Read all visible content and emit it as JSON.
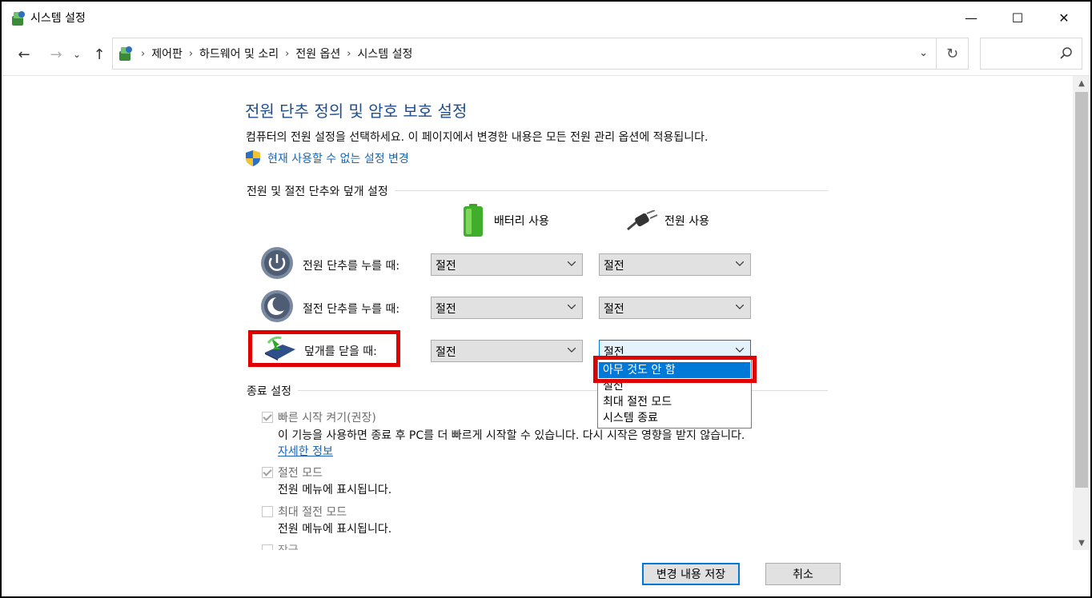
{
  "window": {
    "title": "시스템 설정",
    "minimize_glyph": "—",
    "maximize_glyph": "☐",
    "close_glyph": "✕"
  },
  "nav": {
    "back_glyph": "←",
    "forward_glyph": "→",
    "recent_glyph": "⌄",
    "up_glyph": "↑",
    "breadcrumbs": [
      "제어판",
      "하드웨어 및 소리",
      "전원 옵션",
      "시스템 설정"
    ],
    "separator": "›",
    "refresh_glyph": "↻",
    "search_placeholder": ""
  },
  "page": {
    "title": "전원 단추 정의 및 암호 보호 설정",
    "description": "컴퓨터의 전원 설정을 선택하세요. 이 페이지에서 변경한 내용은 모든 전원 관리 옵션에 적용됩니다.",
    "admin_link": "현재 사용할 수 없는 설정 변경"
  },
  "power_section": {
    "label": "전원 및 절전 단추와 덮개 설정",
    "battery_col": "배터리 사용",
    "plugged_col": "전원 사용",
    "rows": [
      {
        "label": "전원 단추를 누를 때:",
        "battery": "절전",
        "plugged": "절전"
      },
      {
        "label": "절전 단추를 누를 때:",
        "battery": "절전",
        "plugged": "절전"
      },
      {
        "label": "덮개를 닫을 때:",
        "battery": "절전",
        "plugged": "절전"
      }
    ]
  },
  "lid_dropdown": {
    "options": [
      "아무 것도 안 함",
      "절전",
      "최대 절전 모드",
      "시스템 종료"
    ],
    "selected_index": 0
  },
  "shutdown_section": {
    "label": "종료 설정",
    "fast_startup": {
      "label": "빠른 시작 켜기(권장)",
      "checked": true,
      "description": "이 기능을 사용하면 종료 후 PC를 더 빠르게 시작할 수 있습니다. 다시 시작은 영향을 받지 않습니다.",
      "link": "자세한 정보"
    },
    "sleep": {
      "label": "절전 모드",
      "checked": true,
      "description": "전원 메뉴에 표시됩니다."
    },
    "hibernate": {
      "label": "최대 절전 모드",
      "checked": false,
      "description": "전원 메뉴에 표시됩니다."
    },
    "lock_partial": "잠금"
  },
  "buttons": {
    "save": "변경 내용 저장",
    "cancel": "취소"
  },
  "colors": {
    "title_blue": "#1e4e8c",
    "link_blue": "#1a64b4",
    "accent": "#0078d7",
    "highlight_red": "#e00000"
  }
}
